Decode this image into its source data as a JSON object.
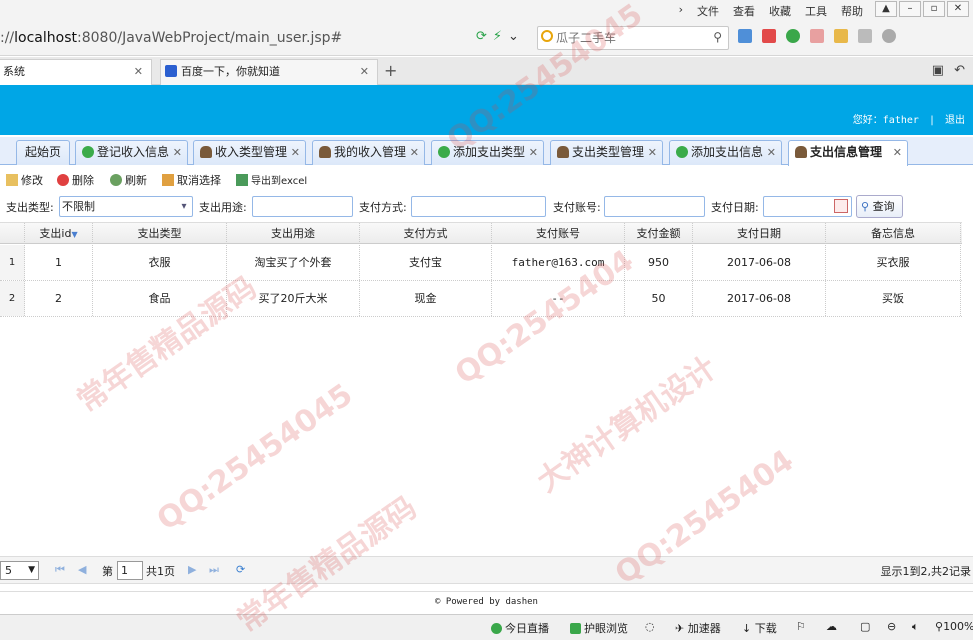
{
  "browser": {
    "menus": [
      "文件",
      "查看",
      "收藏",
      "工具",
      "帮助"
    ],
    "url_prefix": "://",
    "url_host": "localhost",
    "url_rest": ":8080/JavaWebProject/main_user.jsp#",
    "search_placeholder": "瓜子二手车",
    "tabs": [
      {
        "label": "系统"
      },
      {
        "label": "百度一下，你就知道"
      }
    ],
    "new_tab": "+"
  },
  "header": {
    "greeting": "您好：father",
    "separator": "|",
    "logout": "退出"
  },
  "app_tabs": [
    {
      "label": "起始页",
      "icon": "none"
    },
    {
      "label": "登记收入信息",
      "icon": "plus-icon"
    },
    {
      "label": "收入类型管理",
      "icon": "user-icon"
    },
    {
      "label": "我的收入管理",
      "icon": "user-icon"
    },
    {
      "label": "添加支出类型",
      "icon": "plus-icon"
    },
    {
      "label": "支出类型管理",
      "icon": "user-icon"
    },
    {
      "label": "添加支出信息",
      "icon": "plus-icon"
    },
    {
      "label": "支出信息管理",
      "icon": "user-icon"
    }
  ],
  "toolbar": {
    "edit": "修改",
    "delete": "删除",
    "refresh": "刷新",
    "unselect": "取消选择",
    "export": "导出到excel"
  },
  "search": {
    "type_label": "支出类型:",
    "type_value": "不限制",
    "purpose_label": "支出用途:",
    "method_label": "支付方式:",
    "account_label": "支付账号:",
    "date_label": "支付日期:",
    "query_button": "查询"
  },
  "grid": {
    "columns": [
      "支出id",
      "支出类型",
      "支出用途",
      "支付方式",
      "支付账号",
      "支付金额",
      "支付日期",
      "备忘信息"
    ],
    "rows": [
      {
        "num": "1",
        "id": "1",
        "type": "衣服",
        "purpose": "淘宝买了个外套",
        "method": "支付宝",
        "account": "father@163.com",
        "amount": "950",
        "date": "2017-06-08",
        "memo": "买衣服"
      },
      {
        "num": "2",
        "id": "2",
        "type": "食品",
        "purpose": "买了20斤大米",
        "method": "现金",
        "account": "--",
        "amount": "50",
        "date": "2017-06-08",
        "memo": "买饭"
      }
    ]
  },
  "pager": {
    "page_size": "5",
    "page_prefix": "第",
    "page_value": "1",
    "page_total": "共1页",
    "summary": "显示1到2,共2记录"
  },
  "footer": {
    "text": "Powered by dashen"
  },
  "statusbar": {
    "live": "今日直播",
    "eye": "护眼浏览",
    "accelerate": "加速器",
    "download": "下载",
    "zoom": "100%"
  },
  "watermarks": [
    "QQ:25454045",
    "常年售精品源码",
    "大神计算机设计",
    "QQ:2545404"
  ],
  "colors": {
    "header_blue": "#00a6e6",
    "tab_border": "#95b8e7"
  }
}
